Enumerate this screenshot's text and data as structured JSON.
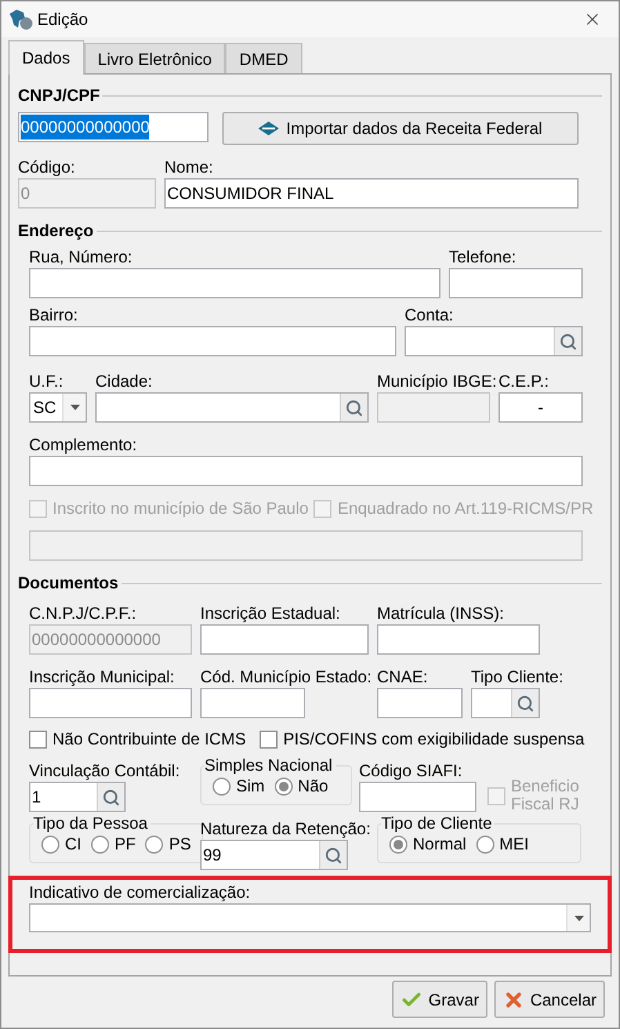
{
  "window": {
    "title": "Edição"
  },
  "tabs": [
    {
      "label": "Dados",
      "selected": true
    },
    {
      "label": "Livro Eletrônico",
      "selected": false
    },
    {
      "label": "DMED",
      "selected": false
    }
  ],
  "sections": [
    {
      "heading": "CNPJ/CPF",
      "rows": [
        {
          "fields": [
            {
              "kind": "text",
              "value": "00000000000000",
              "highlighted": true,
              "disabled": false
            },
            {
              "kind": "button",
              "label": "Importar dados da Receita Federal"
            }
          ]
        },
        {
          "fields": [
            {
              "kind": "text",
              "label": "Código:",
              "value": "0",
              "disabled": true
            },
            {
              "kind": "text",
              "label": "Nome:",
              "value": "CONSUMIDOR FINAL",
              "disabled": false
            }
          ]
        }
      ]
    },
    {
      "heading": "Endereço",
      "rows": [
        {
          "fields": [
            {
              "kind": "text",
              "label": "Rua, Número:",
              "disabled": false
            },
            {
              "kind": "text",
              "label": "Telefone:",
              "disabled": false
            }
          ]
        },
        {
          "fields": [
            {
              "kind": "text",
              "label": "Bairro:",
              "disabled": false
            },
            {
              "kind": "lookup",
              "label": "Conta:"
            }
          ]
        },
        {
          "fields": [
            {
              "kind": "select",
              "label": "U.F.:",
              "value": "SC"
            },
            {
              "kind": "lookup",
              "label": "Cidade:"
            },
            {
              "kind": "text",
              "label": "Município IBGE:",
              "disabled": true
            },
            {
              "kind": "masked",
              "label": "C.E.P.:",
              "value": "-"
            }
          ]
        },
        {
          "fields": [
            {
              "kind": "text",
              "label": "Complemento:",
              "disabled": false
            }
          ]
        },
        {
          "fields": [
            {
              "kind": "checkbox",
              "label": "Inscrito no município de São Paulo",
              "checked": false,
              "disabled": true
            },
            {
              "kind": "checkbox",
              "label": "Enquadrado no Art.119-RICMS/PR",
              "checked": false,
              "disabled": true
            }
          ]
        },
        {
          "fields": [
            {
              "kind": "text",
              "disabled": true
            }
          ]
        }
      ]
    },
    {
      "heading": "Documentos",
      "rows": [
        {
          "fields": [
            {
              "kind": "text",
              "label": "C.N.P.J/C.P.F.:",
              "value": "00000000000000",
              "disabled": true
            },
            {
              "kind": "text",
              "label": "Inscrição Estadual:",
              "disabled": false
            },
            {
              "kind": "text",
              "label": "Matrícula (INSS):",
              "disabled": false
            }
          ]
        },
        {
          "fields": [
            {
              "kind": "text",
              "label": "Inscrição Municipal:",
              "disabled": false
            },
            {
              "kind": "text",
              "label": "Cód. Município Estado:",
              "disabled": false
            },
            {
              "kind": "text",
              "label": "CNAE:",
              "disabled": false
            },
            {
              "kind": "lookup",
              "label": "Tipo Cliente:"
            }
          ]
        },
        {
          "fields": [
            {
              "kind": "checkbox",
              "label": "Não Contribuinte de ICMS",
              "checked": false,
              "disabled": false
            },
            {
              "kind": "checkbox",
              "label": "PIS/COFINS com exigibilidade suspensa",
              "checked": false,
              "disabled": false
            }
          ]
        },
        {
          "fields": [
            {
              "kind": "lookup",
              "label": "Vinculação Contábil:",
              "value": "1"
            },
            {
              "kind": "radio_group",
              "label": "Simples Nacional",
              "options": [
                {
                  "label": "Sim",
                  "selected": false
                },
                {
                  "label": "Não",
                  "selected": true
                }
              ]
            },
            {
              "kind": "text",
              "label": "Código SIAFI:",
              "disabled": false
            },
            {
              "kind": "checkbox",
              "label": "Beneficio Fiscal RJ",
              "checked": false,
              "disabled": true
            }
          ]
        },
        {
          "fields": [
            {
              "kind": "radio_group",
              "label": "Tipo da Pessoa",
              "options": [
                {
                  "label": "CI",
                  "selected": false
                },
                {
                  "label": "PF",
                  "selected": false
                },
                {
                  "label": "PS",
                  "selected": false
                }
              ]
            },
            {
              "kind": "lookup",
              "label": "Natureza da Retenção:",
              "value": "99"
            },
            {
              "kind": "radio_group",
              "label": "Tipo de Cliente",
              "options": [
                {
                  "label": "Normal",
                  "selected": true
                },
                {
                  "label": "MEI",
                  "selected": false
                }
              ]
            }
          ]
        }
      ]
    }
  ],
  "indicativo": {
    "label": "Indicativo de comercialização:"
  },
  "buttons": [
    {
      "kind": "save",
      "label": "Gravar"
    },
    {
      "kind": "cancel",
      "label": "Cancelar"
    }
  ]
}
